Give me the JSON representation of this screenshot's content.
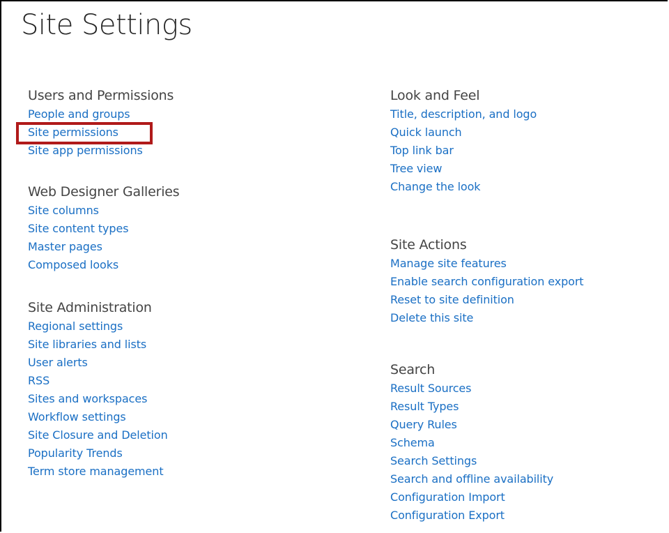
{
  "page": {
    "title": "Site Settings",
    "highlight_color": "#b01a1a",
    "link_color": "#1a6fc4"
  },
  "left_column": [
    {
      "title": "Users and Permissions",
      "links": [
        "People and groups",
        "Site permissions",
        "Site app permissions"
      ]
    },
    {
      "title": "Web Designer Galleries",
      "links": [
        "Site columns",
        "Site content types",
        "Master pages",
        "Composed looks"
      ]
    },
    {
      "title": "Site Administration",
      "links": [
        "Regional settings",
        "Site libraries and lists",
        "User alerts",
        "RSS",
        "Sites and workspaces",
        "Workflow settings",
        "Site Closure and Deletion",
        "Popularity Trends",
        "Term store management"
      ]
    }
  ],
  "right_column": [
    {
      "title": "Look and Feel",
      "links": [
        "Title, description, and logo",
        "Quick launch",
        "Top link bar",
        "Tree view",
        "Change the look"
      ]
    },
    {
      "title": "Site Actions",
      "links": [
        "Manage site features",
        "Enable search configuration export",
        "Reset to site definition",
        "Delete this site"
      ]
    },
    {
      "title": "Search",
      "links": [
        "Result Sources",
        "Result Types",
        "Query Rules",
        "Schema",
        "Search Settings",
        "Search and offline availability",
        "Configuration Import",
        "Configuration Export"
      ]
    }
  ],
  "highlighted_link": "Site permissions"
}
